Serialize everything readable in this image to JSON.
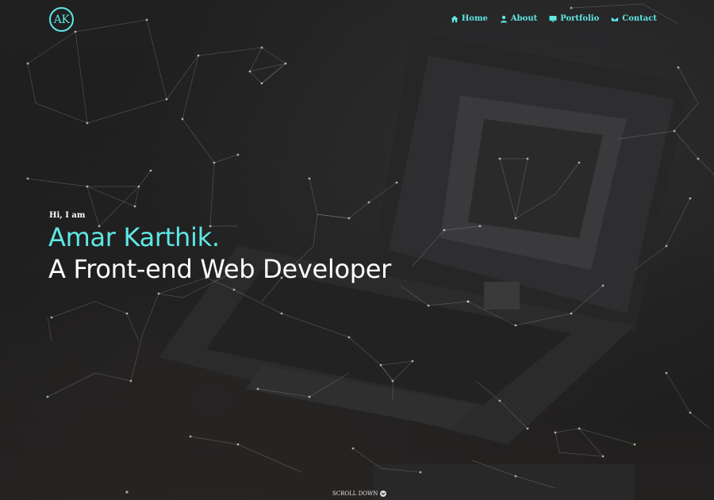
{
  "brand": {
    "logo_text": "AK"
  },
  "nav": {
    "items": [
      {
        "label": "Home",
        "icon": "home-icon"
      },
      {
        "label": "About",
        "icon": "user-icon"
      },
      {
        "label": "Portfolio",
        "icon": "monitor-icon"
      },
      {
        "label": "Contact",
        "icon": "envelope-icon"
      }
    ]
  },
  "hero": {
    "greeting": "Hi, I am",
    "name": "Amar Karthik.",
    "role": "A Front-end Web Developer"
  },
  "scroll": {
    "label": "SCROLL DOWN",
    "icon": "chevron-down-circle-icon"
  },
  "colors": {
    "accent": "#5ee7e4",
    "background": "#1b1b1c",
    "text": "#ffffff"
  }
}
